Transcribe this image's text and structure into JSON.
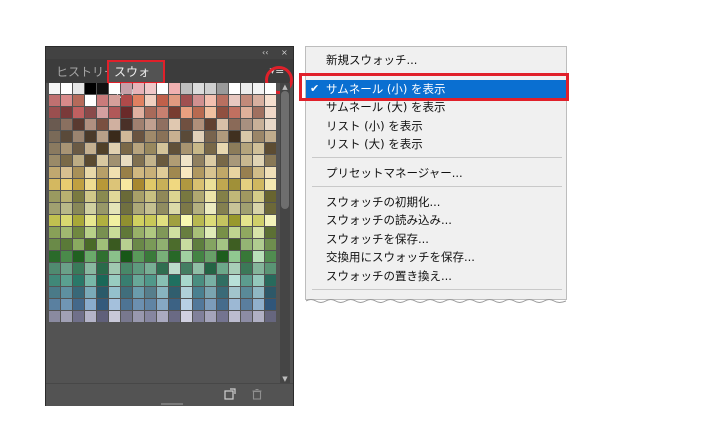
{
  "panel": {
    "collapse_glyph": "‹‹",
    "close_glyph": "×",
    "tabs": [
      {
        "label": "ヒストリー"
      },
      {
        "label": "スウォッチ"
      }
    ],
    "menu_button_glyph": "▾≡",
    "bottom_new_icon": "new-swatch-icon",
    "bottom_delete_icon": "trash-icon",
    "scroll_up": "▲",
    "scroll_down": "▼"
  },
  "menu": {
    "items": [
      {
        "label": "新規スウォッチ..."
      },
      {
        "label": "サムネール (小) を表示",
        "checked": true
      },
      {
        "label": "サムネール (大) を表示"
      },
      {
        "label": "リスト (小) を表示"
      },
      {
        "label": "リスト (大) を表示"
      },
      {
        "label": "プリセットマネージャー..."
      },
      {
        "label": "スウォッチの初期化..."
      },
      {
        "label": "スウォッチの読み込み..."
      },
      {
        "label": "スウォッチを保存..."
      },
      {
        "label": "交換用にスウォッチを保存..."
      },
      {
        "label": "スウォッチの置き換え..."
      }
    ],
    "check_glyph": "✔"
  },
  "colors": {
    "highlight_red": "#e0202a",
    "selection_blue": "#0a6fd1",
    "swatches": [
      "#f5f5f5",
      "#ffffff",
      "#e6e6e6",
      "#000000",
      "#111111",
      "#ffffff",
      "#c7a0a8",
      "#e7b3b8",
      "#f0c8c8",
      "#ffffff",
      "#f0b0b0",
      "#bfbfbf",
      "#dcdcdc",
      "#cfcfcf",
      "#9a9a9a",
      "#ffffff",
      "#ececec",
      "#f3f3f3",
      "#ffffff",
      "#c07070",
      "#d88a8a",
      "#b56a5a",
      "#ffffff",
      "#c97b7b",
      "#d5a09a",
      "#b04a4a",
      "#e08060",
      "#f0d0c0",
      "#c0604a",
      "#e09a80",
      "#a05050",
      "#d09090",
      "#f3c0b0",
      "#b97060",
      "#e8c8c0",
      "#c28a7a",
      "#d7b0a0",
      "#f6e0d0",
      "#9a4f4f",
      "#7a3a3a",
      "#c06060",
      "#8a4a4a",
      "#d4a0a0",
      "#b05858",
      "#6a2a2a",
      "#e0b0a0",
      "#a86a5a",
      "#c88070",
      "#783c30",
      "#e8a080",
      "#b86a50",
      "#f0c0a0",
      "#905040",
      "#c07060",
      "#dfb09a",
      "#a07060",
      "#f0d8c8",
      "#6a5a50",
      "#8a7060",
      "#5a3a30",
      "#b09080",
      "#7a5040",
      "#d0b0a0",
      "#4a3028",
      "#a08070",
      "#c0a090",
      "#907060",
      "#e0c8b0",
      "#705040",
      "#b0907a",
      "#604030",
      "#d8c0a8",
      "#8a6a58",
      "#a89080",
      "#c8b098",
      "#e8d8c8",
      "#7a6a58",
      "#5a4a3a",
      "#9a8470",
      "#4a3a2a",
      "#b8a088",
      "#3a2a1a",
      "#d0b898",
      "#6a5440",
      "#a08a6a",
      "#8a7258",
      "#c8b090",
      "#5a4a38",
      "#e0d0b8",
      "#78644e",
      "#b09a7c",
      "#403020",
      "#d8c8a8",
      "#9a8668",
      "#c0ac8c",
      "#8a7a60",
      "#a89474",
      "#6a5a44",
      "#c4b090",
      "#504028",
      "#e0d0b0",
      "#7a6848",
      "#b8a47e",
      "#98885e",
      "#d4c49a",
      "#605038",
      "#a89470",
      "#c8b888",
      "#786848",
      "#e8d8b0",
      "#8c7c5a",
      "#b4a47c",
      "#d0c098",
      "#5c4c32",
      "#9a8a68",
      "#7a6a48",
      "#bcac84",
      "#5a4a30",
      "#d8c8a0",
      "#a09070",
      "#e8dcc0",
      "#807050",
      "#c4b48c",
      "#6a5a3e",
      "#b09c74",
      "#f0e4c8",
      "#908060",
      "#dccca4",
      "#786848",
      "#a8987a",
      "#c8b890",
      "#e0d4b4",
      "#887856",
      "#c0a870",
      "#d8c090",
      "#a89058",
      "#e8d8a8",
      "#b8a068",
      "#f0e0b0",
      "#988048",
      "#d0b880",
      "#c8b078",
      "#e0cc98",
      "#a08850",
      "#f8e8c0",
      "#b09860",
      "#d8c490",
      "#c0a868",
      "#e8d4a0",
      "#988050",
      "#d0bc88",
      "#f0e0b8",
      "#d4b860",
      "#e8cc70",
      "#c0a040",
      "#f0dc90",
      "#b89838",
      "#dcc478",
      "#f8e8a0",
      "#a88830",
      "#e0c868",
      "#c8b058",
      "#f0d880",
      "#b09840",
      "#d8c070",
      "#ece098",
      "#c0a850",
      "#a09038",
      "#e4d080",
      "#d0b860",
      "#f4e8b0",
      "#9a9a60",
      "#b8b070",
      "#7a7a40",
      "#d0c888",
      "#8a8a50",
      "#e0d898",
      "#6a6a38",
      "#a8a068",
      "#c8c080",
      "#908858",
      "#dcd490",
      "#787840",
      "#b0a870",
      "#ece4a8",
      "#848048",
      "#c0b878",
      "#a09860",
      "#d4cc88",
      "#686430",
      "#a0a070",
      "#b8b888",
      "#888858",
      "#d0d0a0",
      "#989868",
      "#e4e4b8",
      "#707040",
      "#aca878",
      "#c4c090",
      "#908c60",
      "#dcdaa8",
      "#7c7848",
      "#b4b080",
      "#ecebc0",
      "#848050",
      "#c8c498",
      "#a0a070",
      "#d8d4a8",
      "#6c6838",
      "#c0c050",
      "#d8d870",
      "#a8a838",
      "#e8e890",
      "#b0b040",
      "#f0f0a0",
      "#909030",
      "#d0d060",
      "#c8c858",
      "#e0e080",
      "#a0a040",
      "#f8f8b0",
      "#b8b850",
      "#dcdc78",
      "#c4c460",
      "#98982c",
      "#e4e48c",
      "#d0d06a",
      "#f4f4bc",
      "#88a058",
      "#a0b870",
      "#708840",
      "#b8d088",
      "#789050",
      "#c8dc98",
      "#607838",
      "#98b068",
      "#b0c880",
      "#809858",
      "#d0e0a0",
      "#687e40",
      "#a8c078",
      "#e0ecb8",
      "#789048",
      "#c0d490",
      "#90a860",
      "#d8e4a8",
      "#5c7034",
      "#6a8a48",
      "#5a7a38",
      "#8aaa60",
      "#4a6a28",
      "#a0c078",
      "#3a5a20",
      "#b8d090",
      "#6a8848",
      "#7a9a58",
      "#90b070",
      "#4c6c2c",
      "#c8dca0",
      "#5e7e3e",
      "#84a462",
      "#a4c484",
      "#3e5e22",
      "#94b474",
      "#b0cc90",
      "#6e8e4e",
      "#2a6a2a",
      "#4a8a4a",
      "#206020",
      "#6aaa6a",
      "#307030",
      "#8ac08a",
      "#185818",
      "#5a9a5a",
      "#3a7a3a",
      "#78b078",
      "#286828",
      "#a0d0a0",
      "#448444",
      "#68a068",
      "#1e5e1e",
      "#90c890",
      "#387838",
      "#b8e0b8",
      "#508c50",
      "#508a70",
      "#6aa088",
      "#3a7a5a",
      "#88b8a0",
      "#2a6a4a",
      "#a0c8b0",
      "#488868",
      "#5e9a7e",
      "#78ae94",
      "#306e50",
      "#bcdcca",
      "#447e62",
      "#90bea6",
      "#246444",
      "#6ca88a",
      "#a8ceb8",
      "#3c7858",
      "#84b49a",
      "#5a9474",
      "#408878",
      "#5aa090",
      "#2a7868",
      "#78b8a8",
      "#1a6858",
      "#98ccc0",
      "#387e70",
      "#68a898",
      "#50988a",
      "#88c0b4",
      "#207060",
      "#a8d8cc",
      "#4a8e80",
      "#78b0a4",
      "#306e62",
      "#b8e0d8",
      "#5c9c8e",
      "#94c8bc",
      "#286a5c",
      "#4a7a88",
      "#5e90a0",
      "#386878",
      "#7aaab8",
      "#2a5a6a",
      "#94c0cc",
      "#406e7c",
      "#6a9cac",
      "#567e8c",
      "#88b4c0",
      "#305e6e",
      "#b0d0d8",
      "#4a8090",
      "#7aa4b0",
      "#3a6a78",
      "#a2c4cc",
      "#5a8a98",
      "#90b8c4",
      "#2e5868",
      "#5a80a0",
      "#7096b4",
      "#44688a",
      "#8aaccc",
      "#345a7c",
      "#a4c0dc",
      "#4e7494",
      "#6c90b0",
      "#6084a4",
      "#86a8c4",
      "#3c6284",
      "#b8d0e4",
      "#52789a",
      "#7c9cba",
      "#466c8c",
      "#9cb8d4",
      "#5a7e9e",
      "#90b0cc",
      "#30567a",
      "#8a8aa0",
      "#a0a0b4",
      "#70708a",
      "#b4b4c8",
      "#60607a",
      "#c8c8d8",
      "#78788e",
      "#9898ae",
      "#8686a0",
      "#aaaac0",
      "#6a6a84",
      "#d0d0e0",
      "#80809a",
      "#a4a4ba",
      "#747490",
      "#bcbccf",
      "#8c8ca4",
      "#b0b0c4",
      "#66667e"
    ]
  }
}
